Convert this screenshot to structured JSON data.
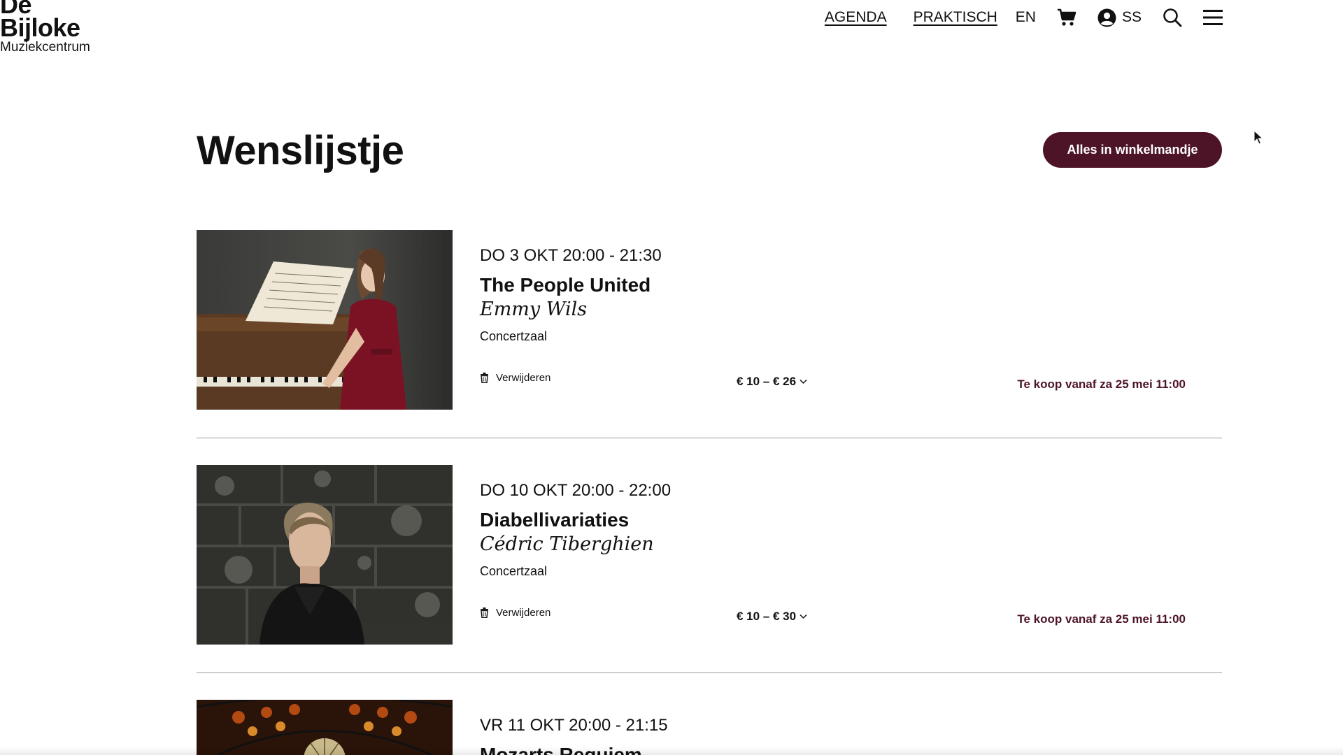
{
  "header": {
    "logo": {
      "line1": "De",
      "line2": "Bijloke",
      "line3": "Muziekcentrum"
    },
    "nav": {
      "agenda": "AGENDA",
      "praktisch": "PRAKTISCH",
      "language": "EN",
      "account_initials": "SS"
    },
    "icons": [
      "cart-icon",
      "user-icon",
      "search-icon",
      "menu-icon"
    ]
  },
  "main": {
    "title": "Wenslijstje",
    "add_all_button": "Alles in winkelmandje",
    "items": [
      {
        "date": "DO 3 OKT 20:00 - 21:30",
        "title": "The People United",
        "artist": "Emmy Wils",
        "venue": "Concertzaal",
        "remove_label": "Verwijderen",
        "price": "€ 10 – € 26",
        "sale_status": "Te koop vanaf za 25 mei 11:00"
      },
      {
        "date": "DO 10 OKT 20:00 - 22:00",
        "title": "Diabellivariaties",
        "artist": "Cédric Tiberghien",
        "venue": "Concertzaal",
        "remove_label": "Verwijderen",
        "price": "€ 10 – € 30",
        "sale_status": "Te koop vanaf za 25 mei 11:00"
      },
      {
        "date": "VR 11 OKT 20:00 - 21:15",
        "title": "Mozarts Requiem"
      }
    ]
  },
  "colors": {
    "accent": "#4d1428",
    "text": "#111111",
    "divider": "#999999"
  }
}
